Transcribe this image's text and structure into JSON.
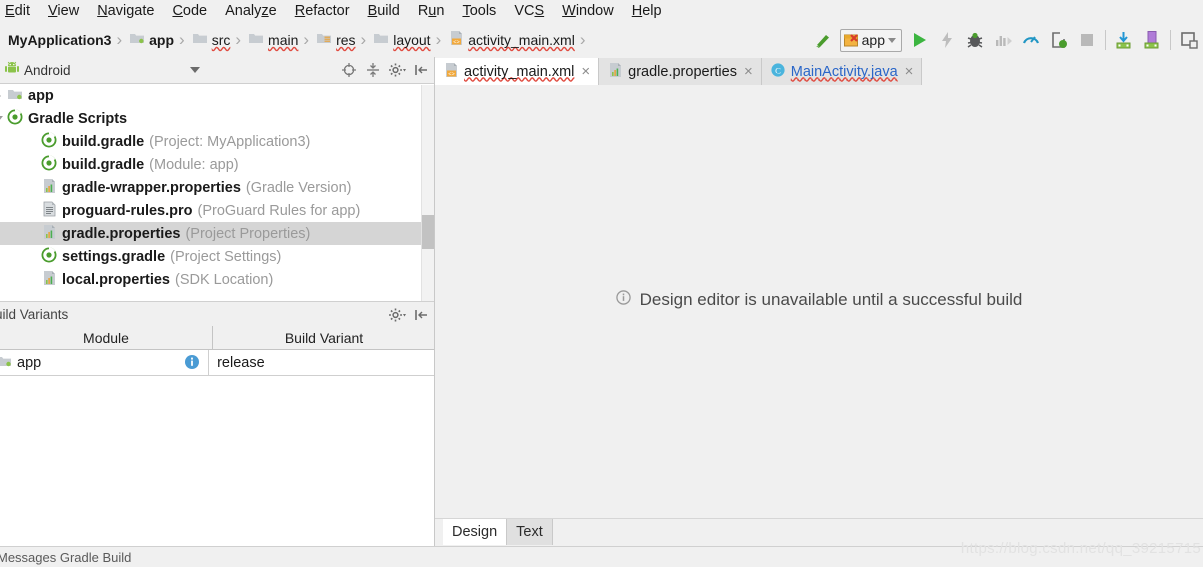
{
  "menubar": {
    "items": [
      {
        "label": "Edit",
        "mnemonic_index": 0
      },
      {
        "label": "View",
        "mnemonic_index": 0
      },
      {
        "label": "Navigate",
        "mnemonic_index": 0
      },
      {
        "label": "Code",
        "mnemonic_index": 0
      },
      {
        "label": "Analyze",
        "mnemonic_index": 5
      },
      {
        "label": "Refactor",
        "mnemonic_index": 0
      },
      {
        "label": "Build",
        "mnemonic_index": 0
      },
      {
        "label": "Run",
        "mnemonic_index": 1
      },
      {
        "label": "Tools",
        "mnemonic_index": 0
      },
      {
        "label": "VCS",
        "mnemonic_index": 2
      },
      {
        "label": "Window",
        "mnemonic_index": 0
      },
      {
        "label": "Help",
        "mnemonic_index": 0
      }
    ]
  },
  "breadcrumb": {
    "separator": "›",
    "items": [
      {
        "label": "MyApplication3",
        "icon": "none",
        "bold": true,
        "squiggle": false
      },
      {
        "label": "app",
        "icon": "module-folder-icon",
        "bold": true,
        "squiggle": false
      },
      {
        "label": "src",
        "icon": "folder-icon",
        "bold": false,
        "squiggle": true
      },
      {
        "label": "main",
        "icon": "folder-icon",
        "bold": false,
        "squiggle": true
      },
      {
        "label": "res",
        "icon": "res-folder-icon",
        "bold": false,
        "squiggle": true
      },
      {
        "label": "layout",
        "icon": "folder-icon",
        "bold": false,
        "squiggle": true
      },
      {
        "label": "activity_main.xml",
        "icon": "xml-layout-icon",
        "bold": false,
        "squiggle": true
      }
    ]
  },
  "toolbar": {
    "run_config_label": "app",
    "buttons": [
      {
        "name": "make-project-button",
        "icon": "hammer-icon"
      },
      {
        "name": "run-button",
        "icon": "play-icon"
      },
      {
        "name": "apply-changes-button",
        "icon": "lightning-icon"
      },
      {
        "name": "debug-button",
        "icon": "bug-icon"
      },
      {
        "name": "run-with-coverage-button",
        "icon": "coverage-icon"
      },
      {
        "name": "profile-button",
        "icon": "gauge-icon"
      },
      {
        "name": "attach-debugger-button",
        "icon": "attach-process-icon"
      },
      {
        "name": "stop-button",
        "icon": "stop-square-icon"
      },
      {
        "name": "sync-project-button",
        "icon": "download-gradle-icon"
      },
      {
        "name": "avd-manager-button",
        "icon": "avd-manager-icon"
      },
      {
        "name": "sdk-manager-button",
        "icon": "sdk-manager-icon"
      }
    ]
  },
  "project_panel": {
    "title": "Android",
    "header_icons": [
      {
        "name": "select-opened-file-icon",
        "glyph": "target"
      },
      {
        "name": "collapse-all-icon",
        "glyph": "collapse"
      },
      {
        "name": "settings-gear-icon",
        "glyph": "gear"
      },
      {
        "name": "hide-panel-icon",
        "glyph": "hide"
      }
    ],
    "tree": [
      {
        "name": "app",
        "note": "",
        "icon": "module-folder-icon",
        "indent": 0,
        "arrow": "collapsed",
        "bold": true,
        "selected": false
      },
      {
        "name": "Gradle Scripts",
        "note": "",
        "icon": "gradle-icon",
        "indent": 0,
        "arrow": "expanded",
        "bold": true,
        "selected": false
      },
      {
        "name": "build.gradle",
        "note": "(Project: MyApplication3)",
        "icon": "gradle-icon",
        "indent": 1,
        "arrow": "none",
        "bold": true,
        "selected": false
      },
      {
        "name": "build.gradle",
        "note": "(Module: app)",
        "icon": "gradle-icon",
        "indent": 1,
        "arrow": "none",
        "bold": true,
        "selected": false
      },
      {
        "name": "gradle-wrapper.properties",
        "note": "(Gradle Version)",
        "icon": "properties-icon",
        "indent": 1,
        "arrow": "none",
        "bold": true,
        "selected": false
      },
      {
        "name": "proguard-rules.pro",
        "note": "(ProGuard Rules for app)",
        "icon": "text-file-icon",
        "indent": 1,
        "arrow": "none",
        "bold": true,
        "selected": false
      },
      {
        "name": "gradle.properties",
        "note": "(Project Properties)",
        "icon": "properties-icon",
        "indent": 1,
        "arrow": "none",
        "bold": true,
        "selected": true
      },
      {
        "name": "settings.gradle",
        "note": "(Project Settings)",
        "icon": "gradle-icon",
        "indent": 1,
        "arrow": "none",
        "bold": true,
        "selected": false
      },
      {
        "name": "local.properties",
        "note": "(SDK Location)",
        "icon": "properties-icon",
        "indent": 1,
        "arrow": "none",
        "bold": true,
        "selected": false
      }
    ]
  },
  "build_variants": {
    "title": "uild Variants",
    "columns": [
      "Module",
      "Build Variant"
    ],
    "rows": [
      {
        "module": "app",
        "variant": "release",
        "has_info": true
      }
    ]
  },
  "editor": {
    "tabs": [
      {
        "label": "activity_main.xml",
        "icon": "xml-layout-icon",
        "active": true,
        "squiggle": true,
        "blue": false,
        "close": "×"
      },
      {
        "label": "gradle.properties",
        "icon": "properties-icon",
        "active": false,
        "squiggle": false,
        "blue": false,
        "close": "×"
      },
      {
        "label": "MainActivity.java",
        "icon": "java-class-icon",
        "active": false,
        "squiggle": true,
        "blue": true,
        "close": "×"
      }
    ],
    "message": "Design editor is unavailable until a successful build",
    "message_icon": "info-icon",
    "bottom_tabs": [
      {
        "label": "Design",
        "active": true
      },
      {
        "label": "Text",
        "active": false
      }
    ]
  },
  "statusbar": {
    "text": "Messages Gradle Build"
  },
  "watermark": {
    "text": "https://blog.csdn.net/qq_39215715"
  },
  "colors": {
    "accent_green": "#4a9c2d",
    "selection_grey": "#d5d5d5",
    "link_blue": "#2a66c8",
    "error_red": "#e04a3f",
    "panel_bg": "#f0f0f0",
    "canvas_bg": "#f0f0f0"
  }
}
